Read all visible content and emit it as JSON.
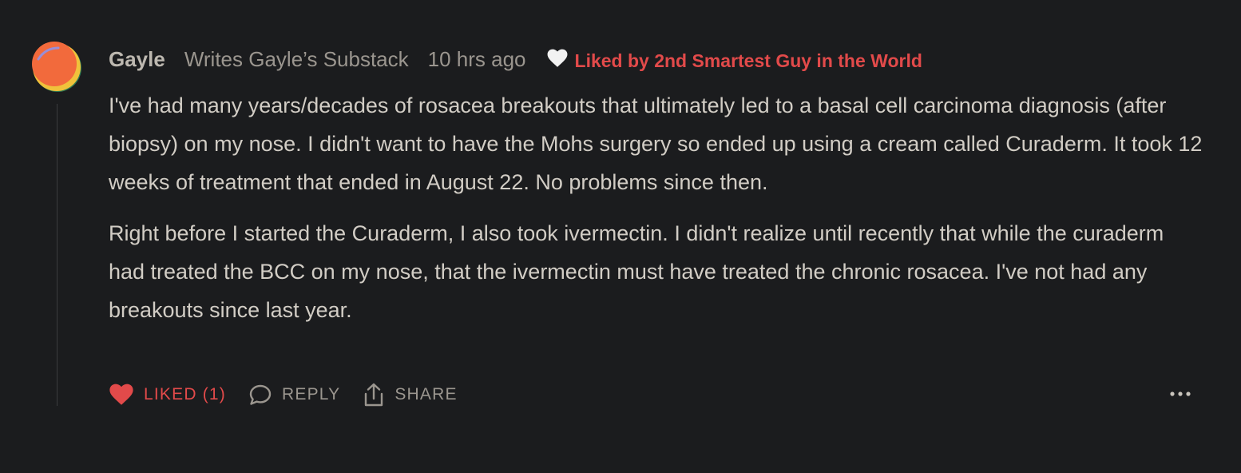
{
  "comment": {
    "author": "Gayle",
    "publication": "Writes Gayle’s Substack",
    "timestamp": "10 hrs ago",
    "liked_by": "Liked by 2nd Smartest Guy in the World",
    "paragraphs": [
      "I've had many years/decades of rosacea breakouts that ultimately led to a basal cell carcinoma diagnosis (after biopsy) on my nose. I didn't want to have the Mohs surgery so ended up using a cream called Curaderm. It took 12 weeks of treatment that ended in August 22. No problems since then.",
      "Right before I started the Curaderm, I also took ivermectin. I didn't realize until recently that while the curaderm had treated the BCC on my nose, that the ivermectin must have treated the chronic rosacea. I've not had any breakouts since last year."
    ]
  },
  "actions": {
    "like_label": "LIKED (1)",
    "reply_label": "REPLY",
    "share_label": "SHARE"
  },
  "icons": {
    "avatar": "avatar",
    "liked_by": "heart-icon",
    "like": "heart-icon",
    "reply": "speech-bubble-icon",
    "share": "share-icon",
    "more": "more-icon"
  },
  "colors": {
    "background": "#1b1c1e",
    "accent": "#e24a4a",
    "text": "#d2cdc5",
    "muted": "#9b968f"
  }
}
